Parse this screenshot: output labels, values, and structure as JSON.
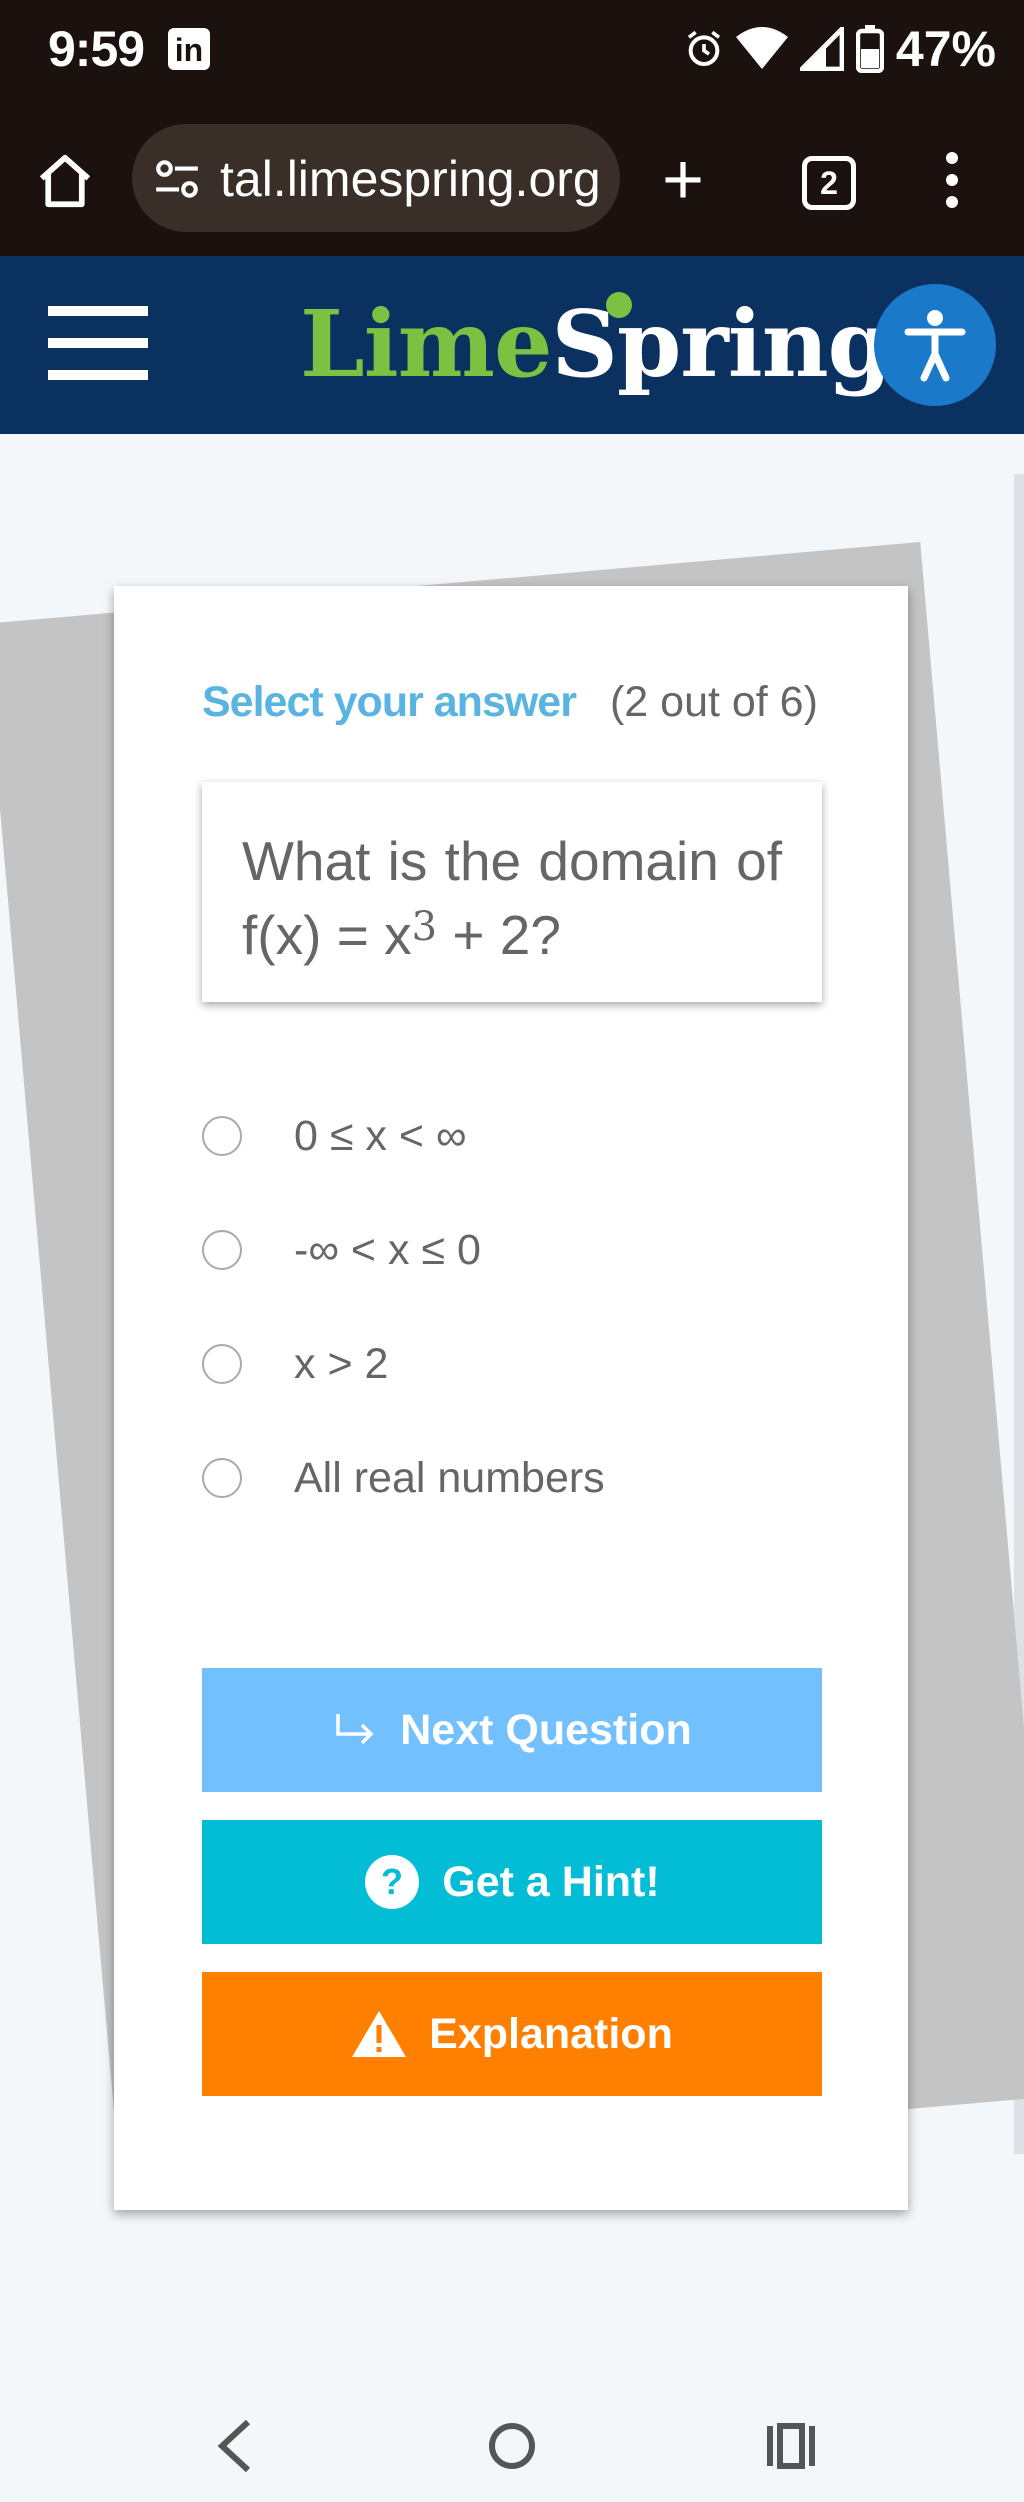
{
  "status_bar": {
    "time": "9:59",
    "battery": "47%"
  },
  "browser": {
    "url": "tal.limespring.org",
    "tab_count": "2"
  },
  "site": {
    "logo_part1": "Lime",
    "logo_part2": "Spring"
  },
  "quiz": {
    "heading": "Select your answer",
    "progress": "(2 out of 6)",
    "question_prefix": "What is the domain of f(x) = x",
    "question_exponent": "3",
    "question_suffix": " + 2?",
    "options": [
      {
        "label": "0 ≤ x < ∞",
        "selected": false
      },
      {
        "label": "-∞ < x ≤ 0",
        "selected": false
      },
      {
        "label": "x > 2",
        "selected": false
      },
      {
        "label": "All real numbers",
        "selected": false
      }
    ],
    "next_label": "Next Question",
    "hint_label": "Get a Hint!",
    "explanation_label": "Explanation"
  },
  "colors": {
    "header_bg": "#0b3161",
    "heading_blue": "#5ab4e2",
    "next_btn": "#72c0fd",
    "hint_btn": "#03bcd6",
    "explanation_btn": "#ff7f00",
    "logo_green": "#7cc242"
  },
  "icons": {
    "next": "return-arrow-icon",
    "hint": "question-circle-icon",
    "explanation": "warning-triangle-icon"
  }
}
